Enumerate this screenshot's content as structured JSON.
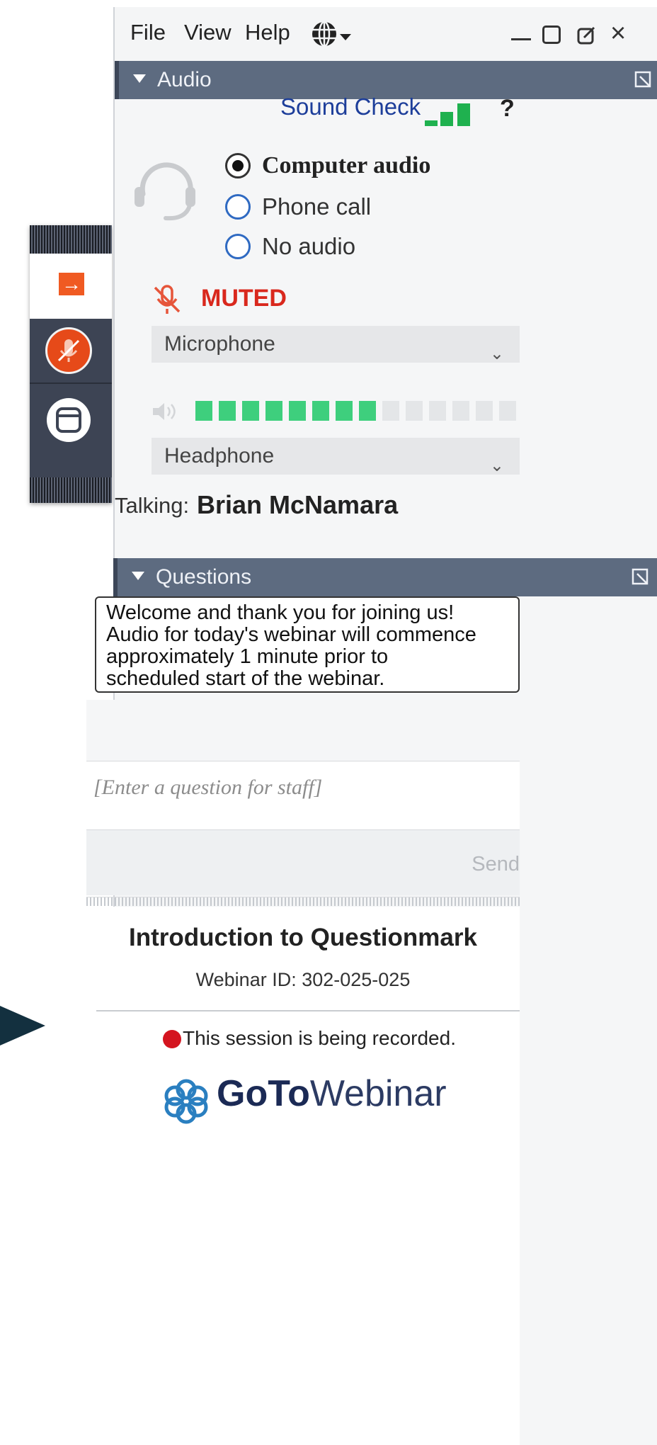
{
  "menu": {
    "file": "File",
    "view": "View",
    "help": "Help"
  },
  "audio": {
    "header": "Audio",
    "sound_check": "Sound Check",
    "help": "?",
    "options": [
      {
        "label": "Computer audio",
        "selected": true
      },
      {
        "label": "Phone call",
        "selected": false
      },
      {
        "label": "No audio",
        "selected": false
      }
    ],
    "muted_label": "MUTED",
    "microphone": "Microphone",
    "headphone": "Headphone",
    "volume_level": 0.6,
    "talking_label": "Talking:",
    "talking_name": "Brian McNamara",
    "colors": {
      "accent": "#1fb14f",
      "muted": "#d9281d",
      "header": "#5d6b80"
    }
  },
  "questions": {
    "header": "Questions",
    "announcement": [
      "Welcome and thank you for joining us!",
      "Audio for today's webinar will commence",
      "approximately 1 minute prior to",
      "scheduled start of the webinar."
    ],
    "placeholder": "[Enter a question for staff]",
    "send": "Send"
  },
  "webinar": {
    "title": "Introduction to Questionmark",
    "id_text": "Webinar ID: 302-025-025",
    "recording": "This session is being recorded.",
    "brand_bold": "GoTo",
    "brand_light": "Webinar"
  },
  "icons": [
    "globe-icon",
    "minimize-icon",
    "maximize-icon",
    "popout-icon",
    "close-icon",
    "headset-icon",
    "muted-mic-icon",
    "speaker-icon",
    "chevron-down-icon",
    "arrow-right-icon",
    "mic-icon",
    "window-icon",
    "gotowebinar-logo"
  ]
}
